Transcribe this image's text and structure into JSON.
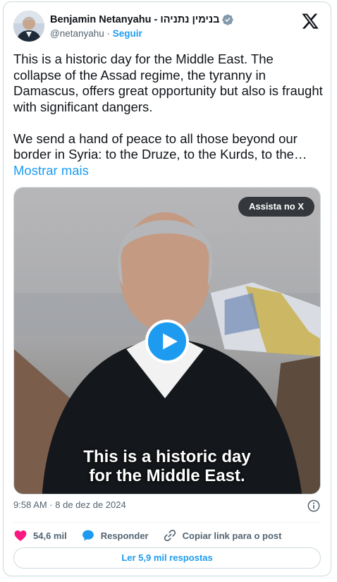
{
  "author": {
    "name": "Benjamin Netanyahu - בנימין נתניהו",
    "handle": "@netanyahu",
    "separator": "·",
    "follow_label": "Seguir"
  },
  "tweet": {
    "paragraph_1": "This is a historic day for the Middle East. The collapse of the Assad regime, the tyranny in Damascus, offers great opportunity but also is fraught with significant dangers.",
    "paragraph_2": "We send a hand of peace to all those beyond our border in Syria: to the Druze, to the Kurds, to the…",
    "show_more": "Mostrar mais"
  },
  "media": {
    "watch_label": "Assista no X",
    "caption_line_1": "This is a historic day",
    "caption_line_2": "for the Middle East."
  },
  "meta": {
    "timestamp": "9:58 AM · 8 de dez de 2024"
  },
  "actions": {
    "likes": "54,6 mil",
    "reply_label": "Responder",
    "copy_link_label": "Copiar link para o post"
  },
  "read_replies_label": "Ler 5,9 mil respostas",
  "icons": {
    "verified": "verified-badge-icon",
    "logo": "x-logo-icon",
    "info": "info-icon",
    "like": "heart-icon",
    "reply": "speech-bubble-icon",
    "link": "link-icon",
    "play": "play-icon"
  },
  "colors": {
    "accent": "#1d9bf0",
    "like": "#f91880",
    "text": "#0f1419",
    "muted": "#536471",
    "border": "#cfd9de"
  }
}
